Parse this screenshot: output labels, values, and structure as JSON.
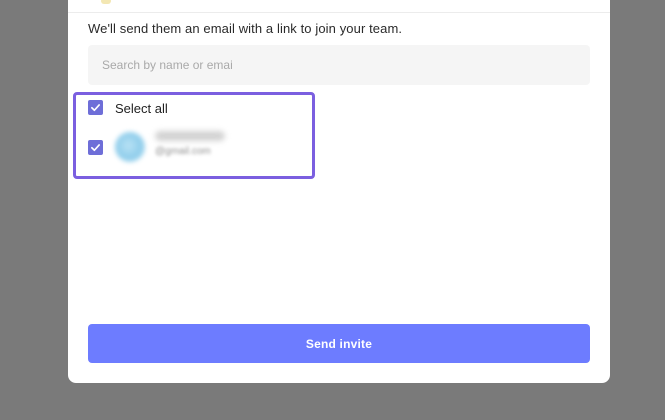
{
  "modal": {
    "subtitle": "We'll send them an email with a link to join your team.",
    "search": {
      "placeholder": "Search by name or emai"
    },
    "select_all": {
      "label": "Select all",
      "checked": true
    },
    "users": [
      {
        "name": "",
        "email": "@gmail.com",
        "checked": true,
        "avatar_color": "#8fcdeb"
      }
    ],
    "send_button": {
      "label": "Send invite"
    }
  },
  "colors": {
    "overlay": "#7a7a7a",
    "checkbox": "#6e6ed8",
    "highlight_border": "#7b5fe0",
    "primary_button": "#6d7cff"
  }
}
